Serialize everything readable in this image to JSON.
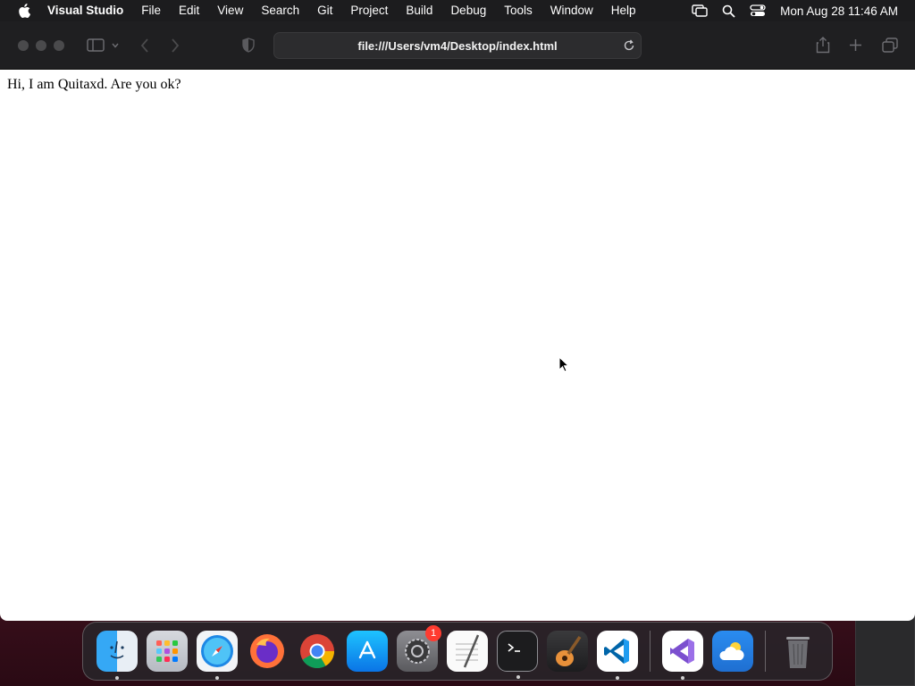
{
  "menubar": {
    "app_name": "Visual Studio",
    "items": [
      "File",
      "Edit",
      "View",
      "Search",
      "Git",
      "Project",
      "Build",
      "Debug",
      "Tools",
      "Window",
      "Help"
    ],
    "clock": "Mon Aug 28  11:46 AM"
  },
  "browser": {
    "url": "file:///Users/vm4/Desktop/index.html"
  },
  "page": {
    "text": "Hi, I am Quitaxd. Are you ok?"
  },
  "dock": {
    "apps": [
      {
        "name": "Finder",
        "icon": "finder-icon",
        "running": true
      },
      {
        "name": "Launchpad",
        "icon": "launchpad-icon",
        "running": false
      },
      {
        "name": "Safari",
        "icon": "safari-icon",
        "running": true
      },
      {
        "name": "Firefox",
        "icon": "firefox-icon",
        "running": false
      },
      {
        "name": "Chrome",
        "icon": "chrome-icon",
        "running": false
      },
      {
        "name": "App Store",
        "icon": "app-store-icon",
        "running": false
      },
      {
        "name": "System Settings",
        "icon": "settings-icon",
        "running": false,
        "badge": "1"
      },
      {
        "name": "TextEdit",
        "icon": "textedit-icon",
        "running": false
      },
      {
        "name": "Terminal",
        "icon": "terminal-icon",
        "running": true
      },
      {
        "name": "GarageBand",
        "icon": "garageband-icon",
        "running": false
      },
      {
        "name": "VS Code",
        "icon": "vscode-icon",
        "running": true
      },
      {
        "name": "Visual Studio",
        "icon": "visual-studio-icon",
        "running": true
      },
      {
        "name": "Weather",
        "icon": "weather-icon",
        "running": false
      },
      {
        "name": "Trash",
        "icon": "trash-icon",
        "running": false
      }
    ]
  }
}
